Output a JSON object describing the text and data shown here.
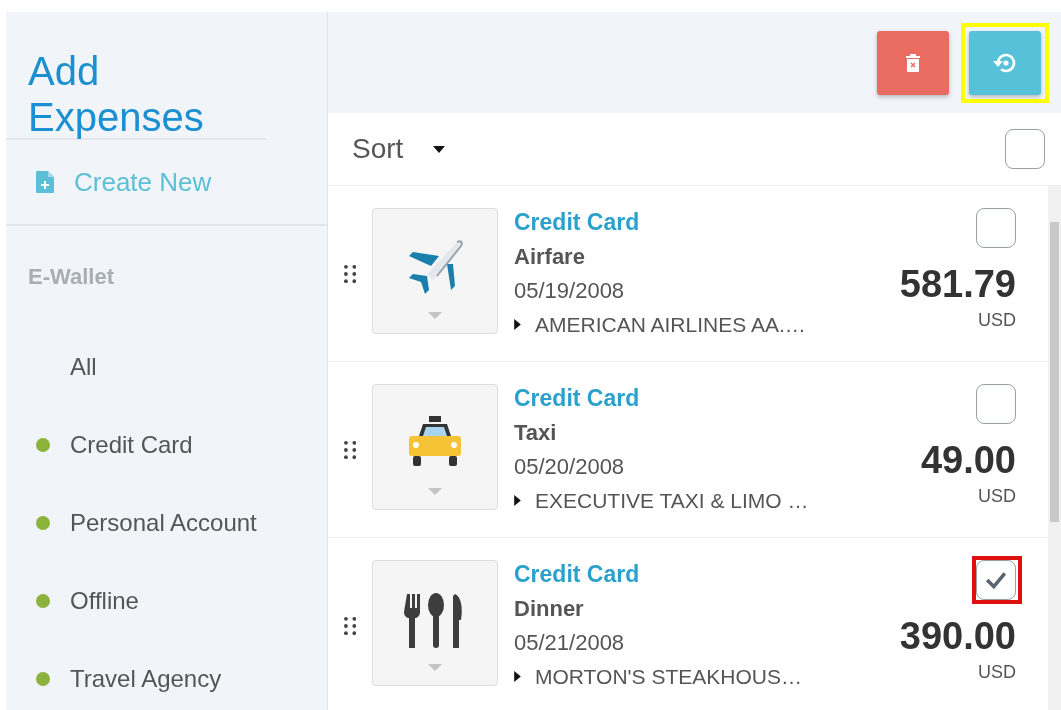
{
  "sidebar": {
    "title": "Add Expenses",
    "create_button": "Create New",
    "section": "E-Wallet",
    "items": [
      {
        "label": "All",
        "selected": false
      },
      {
        "label": "Credit Card",
        "color": "#8cb43c",
        "selected": false
      },
      {
        "label": "Personal Account",
        "color": "#8cb43c",
        "selected": false
      },
      {
        "label": "Offline",
        "color": "#8cb43c",
        "selected": false
      },
      {
        "label": "Travel Agency",
        "color": "#8cb43c",
        "selected": false
      }
    ]
  },
  "toolbar": {
    "buttons": [
      {
        "kind": "delete",
        "highlighted": false
      },
      {
        "kind": "reset",
        "highlighted": true
      }
    ]
  },
  "sort": {
    "label": "Sort",
    "select_all_checked": false
  },
  "expenses": [
    {
      "kind": "plane",
      "source": "Credit Card",
      "name": "Airfare",
      "date": "05/19/2008",
      "description": "AMERICAN AIRLINES AA.…",
      "amount": "581.79",
      "currency": "USD",
      "checked": false,
      "highlighted": false
    },
    {
      "kind": "taxi",
      "source": "Credit Card",
      "name": "Taxi",
      "date": "05/20/2008",
      "description": "EXECUTIVE TAXI & LIMO …",
      "amount": "49.00",
      "currency": "USD",
      "checked": false,
      "highlighted": false
    },
    {
      "kind": "dinner",
      "source": "Credit Card",
      "name": "Dinner",
      "date": "05/21/2008",
      "description": "MORTON'S STEAKHOUS…",
      "amount": "390.00",
      "currency": "USD",
      "checked": true,
      "highlighted": true
    }
  ]
}
